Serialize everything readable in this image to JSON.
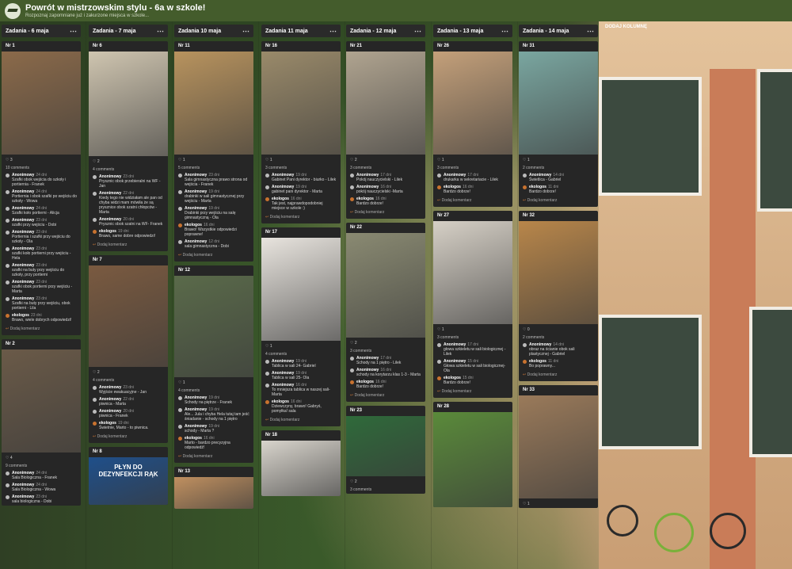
{
  "header": {
    "title": "Powrót w mistrzowskim stylu - 6a w szkole!",
    "subtitle": "Rozpoznaj zapomniane już i zakurzone miejsca w szkole..."
  },
  "add_column": "DODAJ KOLUMNĘ",
  "columns": [
    {
      "title": "Zadania - 6 maja",
      "cards": [
        {
          "nr": "Nr 1",
          "likes": "3",
          "count": "10 comments",
          "img": "#8b6a4a",
          "imgH": 130,
          "comments": [
            {
              "a": "Anonimowy",
              "d": "24 dni",
              "t": "Szafki obok wejścia do szkoły i portiernia - Franek"
            },
            {
              "a": "Anonimowy",
              "d": "24 dni",
              "t": "Portiernia i obok szafki po wejściu do szkoły - Wowa"
            },
            {
              "a": "Anonimowy",
              "d": "24 dni",
              "t": "Szafki koło portierni - Alicja"
            },
            {
              "a": "Anonimowy",
              "d": "23 dni",
              "t": "szafki przy wejściu - Dobi"
            },
            {
              "a": "Anonimowy",
              "d": "23 dni",
              "t": "Portiernia i szafki przy wejściu do szkoły - Ola"
            },
            {
              "a": "Anonimowy",
              "d": "23 dni",
              "t": "szafki koło portierni przy wejściu - Hela"
            },
            {
              "a": "Anonimowy",
              "d": "23 dni",
              "t": "szafki na buty przy wejściu do szkoły, przy portierni"
            },
            {
              "a": "Anonimowy",
              "d": "23 dni",
              "t": "szafki obok portierni przy wejściu - Marta"
            },
            {
              "a": "Anonimowy",
              "d": "23 dni",
              "t": "Szafki na buty przy wejściu, obok portierni - Lila"
            },
            {
              "a": "ekologos",
              "d": "23 dni",
              "t": "Brawo, wiele dobrych odpowiedzi!",
              "o": true
            }
          ],
          "add": "Dodaj komentarz"
        },
        {
          "nr": "Nr 2",
          "likes": "4",
          "count": "9 comments",
          "img": "#6a5a48",
          "imgH": 130,
          "comments": [
            {
              "a": "Anonimowy",
              "d": "24 dni",
              "t": "Sala Biologiczna - Franek"
            },
            {
              "a": "Anonimowy",
              "d": "24 dni",
              "t": "Sala Biologiczna - Wowa"
            },
            {
              "a": "Anonimowy",
              "d": "23 dni",
              "t": "sala biologiczna - Dobi"
            }
          ],
          "add": ""
        }
      ]
    },
    {
      "title": "Zadania - 7 maja",
      "cards": [
        {
          "nr": "Nr 6",
          "likes": "2",
          "count": "4 comments",
          "img": "#cfc5b0",
          "imgH": 132,
          "comments": [
            {
              "a": "Anonimowy",
              "d": "23 dni",
              "t": "Prysznic obok przebieralni na WF - Jan"
            },
            {
              "a": "Anonimowy",
              "d": "22 dni",
              "t": "Kiedy tego nie widziałam ale pan od chyba widzi mam mówiła że są prysznice obok szatni chłopców - Marta"
            },
            {
              "a": "Anonimowy",
              "d": "20 dni",
              "t": "Prysznic obok szatni na WF- Franek"
            },
            {
              "a": "ekologos",
              "d": "19 dni",
              "t": "Brawo, same dobre odpowiedzi!",
              "o": true
            }
          ],
          "add": "Dodaj komentarz"
        },
        {
          "nr": "Nr 7",
          "likes": "2",
          "count": "4 comments",
          "img": "#7a5a40",
          "imgH": 128,
          "comments": [
            {
              "a": "Anonimowy",
              "d": "23 dni",
              "t": "Wyjście ewakuacyjne - Jan"
            },
            {
              "a": "Anonimowy",
              "d": "22 dni",
              "t": "piwnica - Marta"
            },
            {
              "a": "Anonimowy",
              "d": "20 dni",
              "t": "piwnica - Franek"
            },
            {
              "a": "ekologos",
              "d": "19 dni",
              "t": "Świetnie, Marto - to piwnica.",
              "o": true
            }
          ],
          "add": "Dodaj komentarz"
        },
        {
          "nr": "Nr 8",
          "likes": "",
          "count": "",
          "img": "#1f4f8a",
          "imgH": 60,
          "comments": [],
          "add": "",
          "label": "PŁYN DO DEZYNFEKCJI RĄK"
        }
      ]
    },
    {
      "title": "Zadania 10 maja",
      "cards": [
        {
          "nr": "Nr 11",
          "likes": "1",
          "count": "5 comments",
          "img": "#b8935e",
          "imgH": 130,
          "comments": [
            {
              "a": "Anonimowy",
              "d": "23 dni",
              "t": "Sala gimnastyczna prawo strona od wejścia - Franek"
            },
            {
              "a": "Anonimowy",
              "d": "19 dni",
              "t": "drabinki w sali gimnastycznej przy wejściu - Marta"
            },
            {
              "a": "Anonimowy",
              "d": "19 dni",
              "t": "Drabinki przy wejściu na salę gimnastyczną - Ola"
            },
            {
              "a": "ekologos",
              "d": "16 dni",
              "t": "Brawo! Wszystkie odpowiedzi poprawne!",
              "o": true
            },
            {
              "a": "Anonimowy",
              "d": "12 dni",
              "t": "sala gimnastyczna - Dobi"
            }
          ],
          "add": "Dodaj komentarz"
        },
        {
          "nr": "Nr 12",
          "likes": "1",
          "count": "4 comments",
          "img": "#5a6a4a",
          "imgH": 128,
          "comments": [
            {
              "a": "Anonimowy",
              "d": "19 dni",
              "t": "Schody na piętrze - Franek"
            },
            {
              "a": "Anonimowy",
              "d": "19 dni",
              "t": "Ale... Jula i chyba Hela tutaj tam jeść śniadanie - schody na 1 piętro"
            },
            {
              "a": "Anonimowy",
              "d": "19 dni",
              "t": "schody - Marta ?"
            },
            {
              "a": "ekologos",
              "d": "16 dni",
              "t": "Marto - bardzo precyzyjna odpowiedź!",
              "o": true
            }
          ],
          "add": "Dodaj komentarz"
        },
        {
          "nr": "Nr 13",
          "likes": "",
          "count": "",
          "img": "#c09060",
          "imgH": 40,
          "comments": [],
          "add": ""
        }
      ]
    },
    {
      "title": "Zadania 11 maja",
      "cards": [
        {
          "nr": "Nr 16",
          "likes": "1",
          "count": "3 comments",
          "img": "#9a8a6a",
          "imgH": 130,
          "comments": [
            {
              "a": "Anonimowy",
              "d": "19 dni",
              "t": "Gabinet Pani dyrektor - biurko - Lilek"
            },
            {
              "a": "Anonimowy",
              "d": "19 dni",
              "t": "gabinet pani dyrektor - Marta"
            },
            {
              "a": "ekologos",
              "d": "16 dni",
              "t": "Tak jest, najprawdopodobniej miejsce w szkole :)",
              "o": true
            }
          ],
          "add": "Dodaj komentarz"
        },
        {
          "nr": "Nr 17",
          "likes": "1",
          "count": "4 comments",
          "img": "#e8e4de",
          "imgH": 130,
          "comments": [
            {
              "a": "Anonimowy",
              "d": "19 dni",
              "t": "Tablica w sali 24- Gabriel"
            },
            {
              "a": "Anonimowy",
              "d": "19 dni",
              "t": "Tablica w sali 25- Ola"
            },
            {
              "a": "Anonimowy",
              "d": "16 dni",
              "t": "To mniejsza tablica w naszej sali- Marta"
            },
            {
              "a": "ekologos",
              "d": "16 dni",
              "t": "Dziewczyny, brawo! Gabryś, pomyłka! sala",
              "o": true
            }
          ],
          "add": "Dodaj komentarz"
        },
        {
          "nr": "Nr 18",
          "likes": "",
          "count": "",
          "img": "#d8d4cc",
          "imgH": 70,
          "comments": [],
          "add": ""
        }
      ]
    },
    {
      "title": "Zadania - 12 maja",
      "cards": [
        {
          "nr": "Nr 21",
          "likes": "2",
          "count": "3 comments",
          "img": "#b0a490",
          "imgH": 130,
          "comments": [
            {
              "a": "Anonimowy",
              "d": "17 dni",
              "t": "Pokój nauczycielski - Lilek"
            },
            {
              "a": "Anonimowy",
              "d": "16 dni",
              "t": "pokój nauczycielski -Marta"
            },
            {
              "a": "ekologos",
              "d": "16 dni",
              "t": "Bardzo dobrze!",
              "o": true
            }
          ],
          "add": "Dodaj komentarz"
        },
        {
          "nr": "Nr 22",
          "likes": "2",
          "count": "3 comments",
          "img": "#8a8a72",
          "imgH": 132,
          "comments": [
            {
              "a": "Anonimowy",
              "d": "17 dni",
              "t": "Schody na 1 piętro - Lilek"
            },
            {
              "a": "Anonimowy",
              "d": "16 dni",
              "t": "schody na korytarzu klas 1-3 - Marta"
            },
            {
              "a": "ekologos",
              "d": "16 dni",
              "t": "Bardzo dobrze!",
              "o": true
            }
          ],
          "add": "Dodaj komentarz"
        },
        {
          "nr": "Nr 23",
          "likes": "2",
          "count": "3 comments",
          "img": "#2f6a3a",
          "imgH": 76,
          "comments": [],
          "add": ""
        }
      ]
    },
    {
      "title": "Zadania - 13 maja",
      "cards": [
        {
          "nr": "Nr 26",
          "likes": "1",
          "count": "3 comments",
          "img": "#c4a07a",
          "imgH": 130,
          "comments": [
            {
              "a": "Anonimowy",
              "d": "17 dni",
              "t": "drukarka w sekretariacie - Lilek"
            },
            {
              "a": "ekologos",
              "d": "16 dni",
              "t": "Bardzo dobrze!",
              "o": true
            }
          ],
          "add": "Dodaj komentarz"
        },
        {
          "nr": "Nr 27",
          "likes": "1",
          "count": "3 comments",
          "img": "#d6d0c6",
          "imgH": 130,
          "comments": [
            {
              "a": "Anonimowy",
              "d": "17 dni",
              "t": "głowa szkieletu w sali biologicznej - Lilek"
            },
            {
              "a": "Anonimowy",
              "d": "15 dni",
              "t": "Głowa szkieletu w sali biologicznej- Ola"
            },
            {
              "a": "ekologos",
              "d": "15 dni",
              "t": "Bardzo dobrze!",
              "o": true
            }
          ],
          "add": "Dodaj komentarz"
        },
        {
          "nr": "Nr 28",
          "likes": "",
          "count": "",
          "img": "#5a8a3a",
          "imgH": 120,
          "comments": [],
          "add": ""
        }
      ]
    },
    {
      "title": "Zadania - 14 maja",
      "cards": [
        {
          "nr": "Nr 31",
          "likes": "1",
          "count": "2 comments",
          "img": "#7aa6a0",
          "imgH": 130,
          "comments": [
            {
              "a": "Anonimowy",
              "d": "14 dni",
              "t": "Świetlica - Gabriel"
            },
            {
              "a": "ekologos",
              "d": "11 dni",
              "t": "Bardzo dobrze!",
              "o": true
            }
          ],
          "add": "Dodaj komentarz"
        },
        {
          "nr": "Nr 32",
          "likes": "0",
          "count": "2 comments",
          "img": "#b8864a",
          "imgH": 130,
          "comments": [
            {
              "a": "Anonimowy",
              "d": "14 dni",
              "t": "obraz na ścianie obok sali plastycznej - Gabriel"
            },
            {
              "a": "ekologos",
              "d": "11 dni",
              "t": "Bo poprawny...",
              "o": true
            }
          ],
          "add": "Dodaj komentarz"
        },
        {
          "nr": "Nr 33",
          "likes": "1",
          "count": "",
          "img": "#9a7a5a",
          "imgH": 130,
          "comments": [],
          "add": ""
        }
      ]
    }
  ]
}
